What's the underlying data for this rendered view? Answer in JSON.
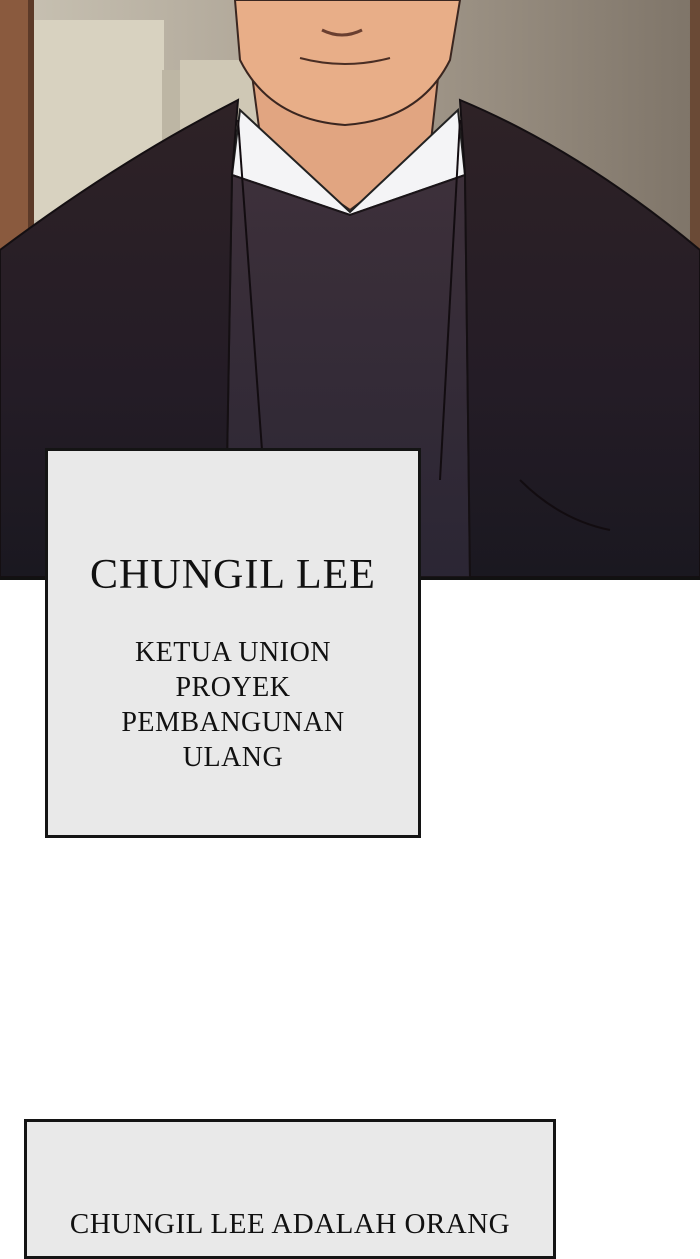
{
  "panel": {
    "illustration": "man-in-dark-jacket-illustration"
  },
  "caption_box_1": {
    "name": "CHUNGIL LEE",
    "role_lines": [
      "KETUA UNION",
      "PROYEK",
      "PEMBANGUNAN",
      "ULANG"
    ]
  },
  "caption_box_2": {
    "text": "CHUNGIL LEE ADALAH ORANG"
  },
  "colors": {
    "caption_bg": "#e9e9e9",
    "border": "#141414",
    "jacket": "#2a2028",
    "sweater": "#3c3240",
    "wall": "#a49a8c",
    "page_bg": "#ffffff"
  }
}
